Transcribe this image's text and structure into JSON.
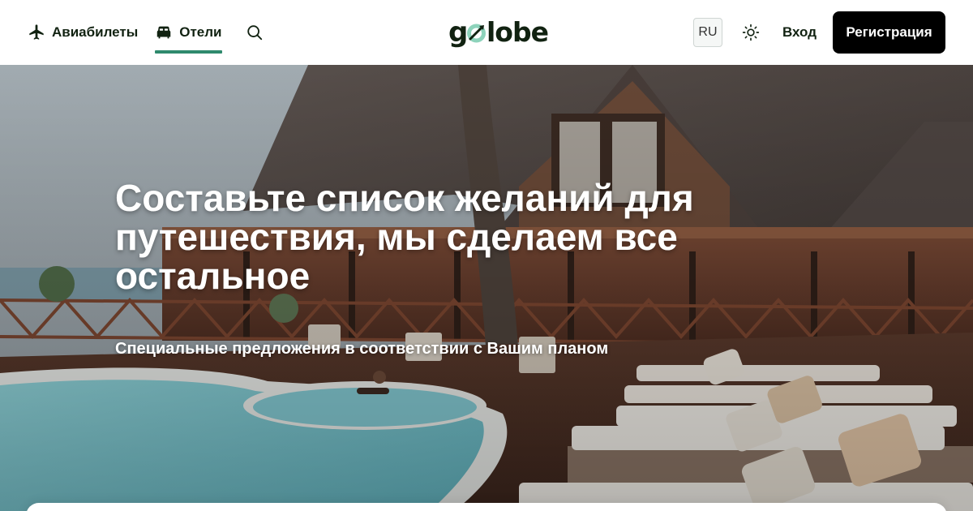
{
  "header": {
    "nav": {
      "flights_label": "Авиабилеты",
      "hotels_label": "Отели"
    },
    "logo_text": "golobe",
    "language": "RU",
    "login_label": "Вход",
    "signup_label": "Регистрация"
  },
  "hero": {
    "title": "Составьте список желаний для путешествия, мы сделаем все остальное",
    "subtitle": "Специальные предложения в соответствии с Вашим планом"
  },
  "colors": {
    "accent": "#2f8a6d",
    "logo_mint": "#8dd3bb",
    "text_dark": "#112211",
    "button_black": "#000000"
  },
  "icons": {
    "flights": "airplane-icon",
    "hotels": "bed-icon",
    "search": "search-icon",
    "theme": "sun-icon"
  }
}
